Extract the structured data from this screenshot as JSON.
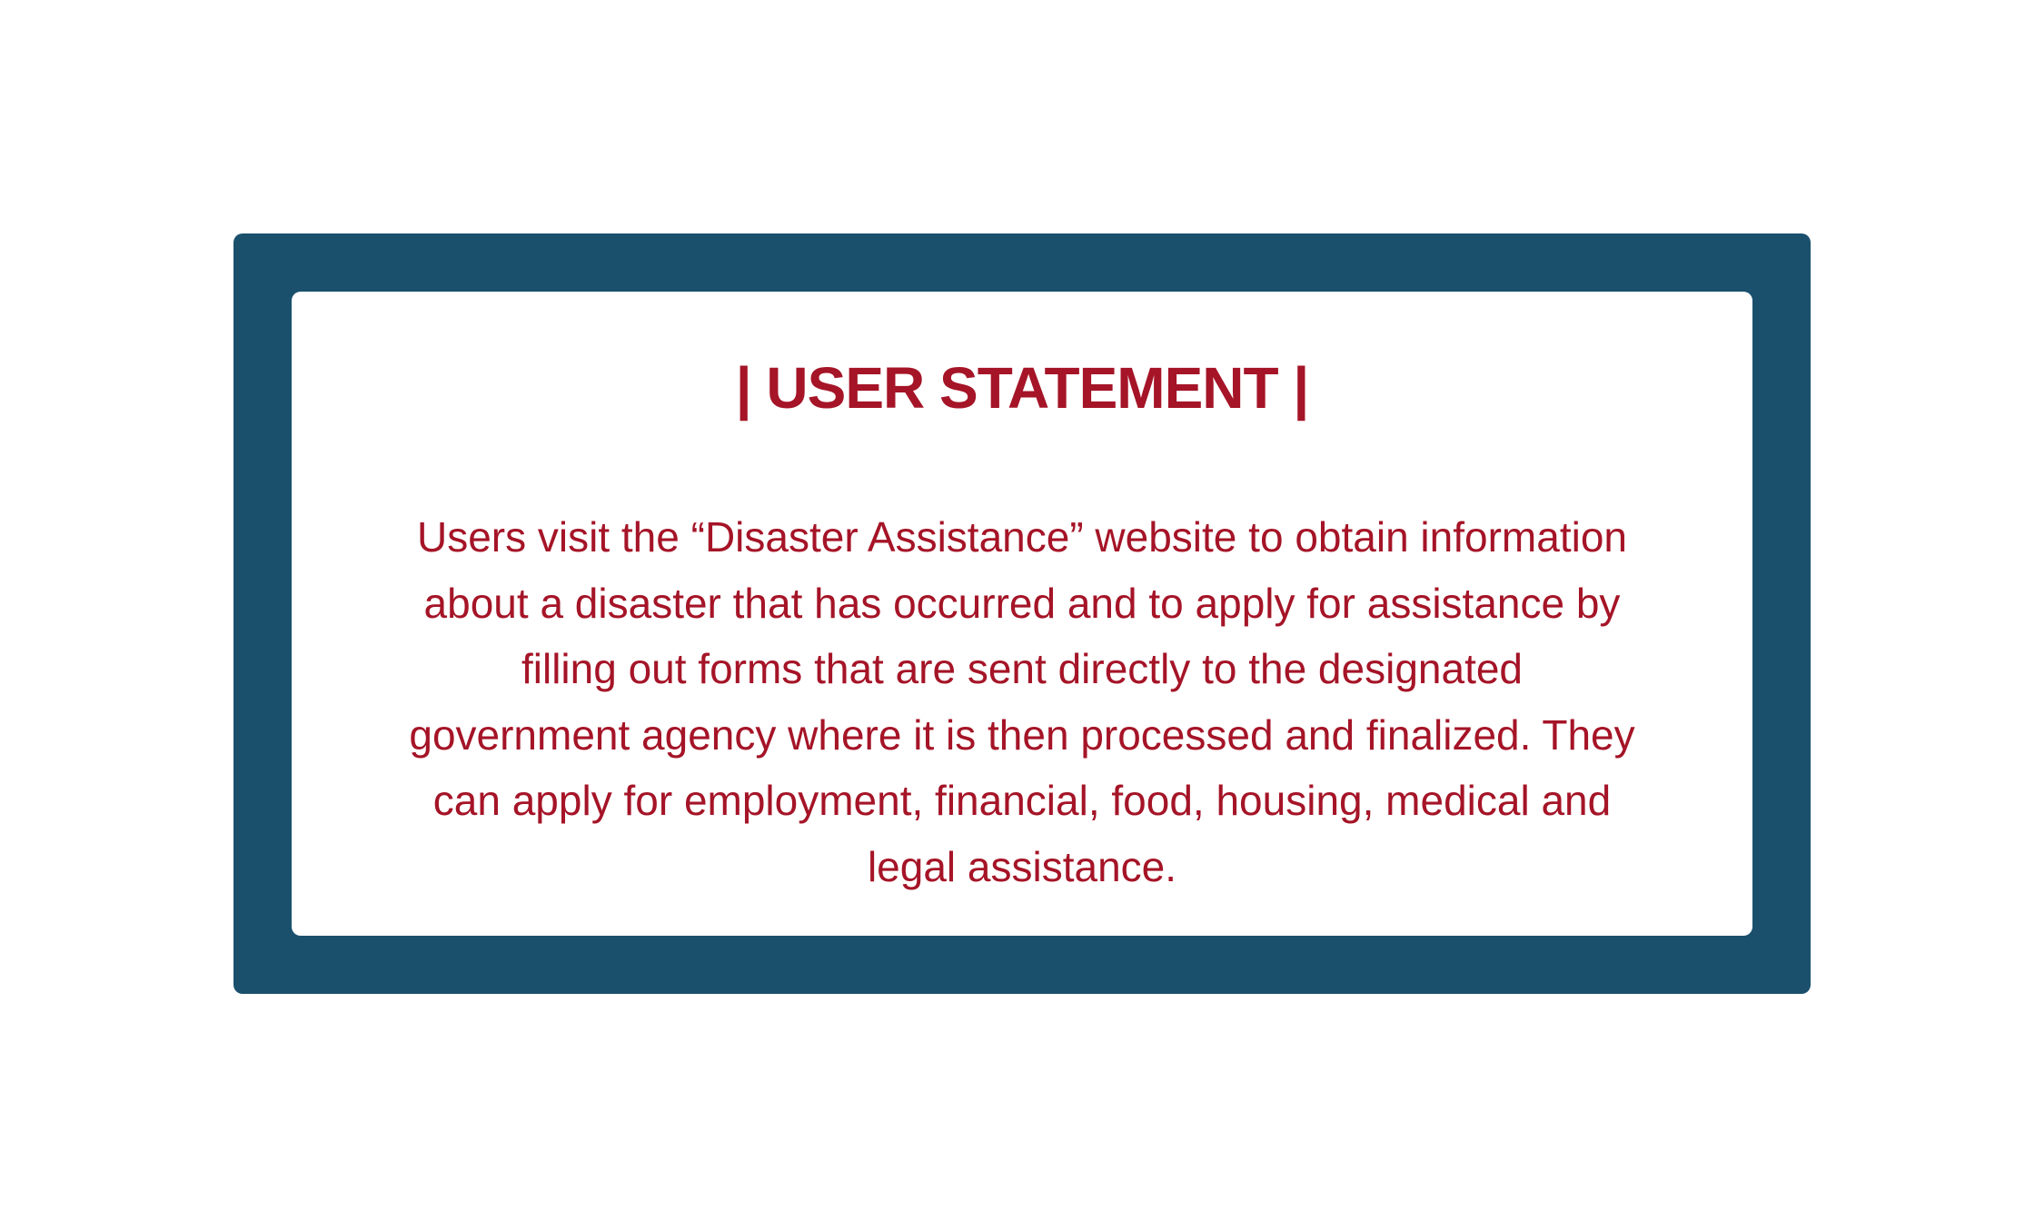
{
  "colors": {
    "frame": "#1b506d",
    "card_background": "#ffffff",
    "text": "#a51427",
    "page_background": "#ffffff"
  },
  "card": {
    "title": "| USER STATEMENT |",
    "body_lines": [
      "Users visit the “Disaster Assistance” website to obtain information",
      "about a disaster that has occurred and to apply for assistance by",
      "filling out forms that are sent directly to the designated",
      "government agency where it is then processed and finalized. They",
      "can apply for employment, financial, food, housing, medical and",
      "legal assistance."
    ]
  }
}
